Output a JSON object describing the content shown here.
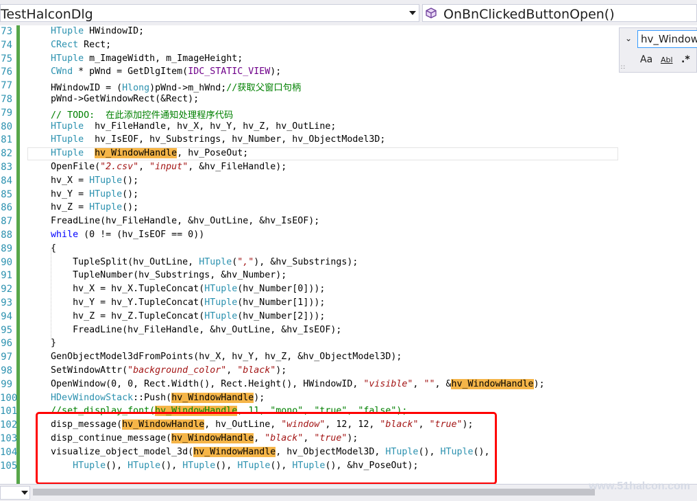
{
  "header": {
    "class_combo": "TestHalconDlg",
    "method_combo": "OnBnClickedButtonOpen()"
  },
  "find": {
    "query": "hv_Window",
    "opt_case": "Aa",
    "opt_word": "Abl",
    "opt_regex": ".*"
  },
  "watermark": "www.51halcon.com",
  "lines": [
    {
      "n": "73",
      "t": [
        [
          "        "
        ],
        [
          "HTuple",
          "type"
        ],
        [
          " HWindowID;"
        ]
      ]
    },
    {
      "n": "74",
      "t": [
        [
          "        "
        ],
        [
          "CRect",
          "type"
        ],
        [
          " Rect;"
        ]
      ]
    },
    {
      "n": "75",
      "t": [
        [
          "        "
        ],
        [
          "HTuple",
          "type"
        ],
        [
          " m_ImageWidth, m_ImageHeight;"
        ]
      ]
    },
    {
      "n": "76",
      "t": [
        [
          "        "
        ],
        [
          "CWnd",
          "type"
        ],
        [
          " * pWnd = GetDlgItem("
        ],
        [
          "IDC_STATIC_VIEW",
          "mac"
        ],
        [
          ");"
        ]
      ]
    },
    {
      "n": "77",
      "t": [
        [
          "        HWindowID = ("
        ],
        [
          "Hlong",
          "type"
        ],
        [
          ")pWnd->m_hWnd;"
        ],
        [
          "//获取父窗口句柄",
          "cmt"
        ]
      ]
    },
    {
      "n": "78",
      "t": [
        [
          "        pWnd->GetWindowRect(&Rect);"
        ]
      ]
    },
    {
      "n": "79",
      "t": [
        [
          "        "
        ],
        [
          "// TODO:  在此添加控件通知处理程序代码",
          "cmt"
        ]
      ]
    },
    {
      "n": "80",
      "t": [
        [
          "        "
        ],
        [
          "HTuple",
          "type"
        ],
        [
          "  hv_FileHandle, hv_X, hv_Y, hv_Z, hv_OutLine;"
        ]
      ]
    },
    {
      "n": "81",
      "t": [
        [
          "        "
        ],
        [
          "HTuple",
          "type"
        ],
        [
          "  hv_IsEOF, hv_Substrings, hv_Number, hv_ObjectModel3D;"
        ]
      ]
    },
    {
      "n": "82",
      "t": [
        [
          "        "
        ],
        [
          "HTuple",
          "type"
        ],
        [
          "  "
        ],
        [
          "hv_WindowHandle",
          "hl"
        ],
        [
          ", hv_PoseOut;"
        ]
      ]
    },
    {
      "n": "83",
      "t": [
        [
          "        OpenFile("
        ],
        [
          "\"2.csv\"",
          "str"
        ],
        [
          ", "
        ],
        [
          "\"input\"",
          "str"
        ],
        [
          ", &hv_FileHandle);"
        ]
      ]
    },
    {
      "n": "84",
      "t": [
        [
          "        hv_X = "
        ],
        [
          "HTuple",
          "type"
        ],
        [
          "();"
        ]
      ]
    },
    {
      "n": "85",
      "t": [
        [
          "        hv_Y = "
        ],
        [
          "HTuple",
          "type"
        ],
        [
          "();"
        ]
      ]
    },
    {
      "n": "86",
      "t": [
        [
          "        hv_Z = "
        ],
        [
          "HTuple",
          "type"
        ],
        [
          "();"
        ]
      ]
    },
    {
      "n": "87",
      "t": [
        [
          "        FreadLine(hv_FileHandle, &hv_OutLine, &hv_IsEOF);"
        ]
      ]
    },
    {
      "n": "88",
      "t": [
        [
          "        "
        ],
        [
          "while",
          "kw"
        ],
        [
          " (0 != (hv_IsEOF == 0))"
        ]
      ]
    },
    {
      "n": "89",
      "t": [
        [
          "        {"
        ]
      ]
    },
    {
      "n": "90",
      "t": [
        [
          "            TupleSplit(hv_OutLine, "
        ],
        [
          "HTuple",
          "type"
        ],
        [
          "("
        ],
        [
          "\",\"",
          "str"
        ],
        [
          "), &hv_Substrings);"
        ]
      ]
    },
    {
      "n": "91",
      "t": [
        [
          "            TupleNumber(hv_Substrings, &hv_Number);"
        ]
      ]
    },
    {
      "n": "92",
      "t": [
        [
          "            hv_X = hv_X.TupleConcat("
        ],
        [
          "HTuple",
          "type"
        ],
        [
          "(hv_Number[0]));"
        ]
      ]
    },
    {
      "n": "93",
      "t": [
        [
          "            hv_Y = hv_Y.TupleConcat("
        ],
        [
          "HTuple",
          "type"
        ],
        [
          "(hv_Number[1]));"
        ]
      ]
    },
    {
      "n": "94",
      "t": [
        [
          "            hv_Z = hv_Z.TupleConcat("
        ],
        [
          "HTuple",
          "type"
        ],
        [
          "(hv_Number[2]));"
        ]
      ]
    },
    {
      "n": "95",
      "t": [
        [
          "            FreadLine(hv_FileHandle, &hv_OutLine, &hv_IsEOF);"
        ]
      ]
    },
    {
      "n": "96",
      "t": [
        [
          "        }"
        ]
      ]
    },
    {
      "n": "97",
      "t": [
        [
          "        GenObjectModel3dFromPoints(hv_X, hv_Y, hv_Z, &hv_ObjectModel3D);"
        ]
      ]
    },
    {
      "n": "98",
      "t": [
        [
          "        SetWindowAttr("
        ],
        [
          "\"background_color\"",
          "str"
        ],
        [
          ", "
        ],
        [
          "\"black\"",
          "str"
        ],
        [
          ");"
        ]
      ]
    },
    {
      "n": "99",
      "t": [
        [
          "        OpenWindow(0, 0, Rect.Width(), Rect.Height(), HWindowID, "
        ],
        [
          "\"visible\"",
          "str"
        ],
        [
          ", "
        ],
        [
          "\"\"",
          "str"
        ],
        [
          ", &"
        ],
        [
          "hv_WindowHandle",
          "hl"
        ],
        [
          ");"
        ]
      ]
    },
    {
      "n": "100",
      "t": [
        [
          "        "
        ],
        [
          "HDevWindowStack",
          "type"
        ],
        [
          "::Push("
        ],
        [
          "hv_WindowHandle",
          "hl"
        ],
        [
          ");"
        ]
      ]
    },
    {
      "n": "101",
      "t": [
        [
          "        "
        ],
        [
          "//set_display_font(",
          "cmt"
        ],
        [
          "hv_WindowHandle",
          "hl cmt"
        ],
        [
          ", 11, \"mono\", \"true\", \"false\");",
          "cmt"
        ]
      ]
    },
    {
      "n": "102",
      "t": [
        [
          "        disp_message("
        ],
        [
          "hv_WindowHandle",
          "hl"
        ],
        [
          ", hv_OutLine, "
        ],
        [
          "\"window\"",
          "str"
        ],
        [
          ", 12, 12, "
        ],
        [
          "\"black\"",
          "str"
        ],
        [
          ", "
        ],
        [
          "\"true\"",
          "str"
        ],
        [
          ");"
        ]
      ]
    },
    {
      "n": "103",
      "t": [
        [
          "        disp_continue_message("
        ],
        [
          "hv_WindowHandle",
          "hl"
        ],
        [
          ", "
        ],
        [
          "\"black\"",
          "str"
        ],
        [
          ", "
        ],
        [
          "\"true\"",
          "str"
        ],
        [
          ");"
        ]
      ]
    },
    {
      "n": "104",
      "t": [
        [
          "        visualize_object_model_3d("
        ],
        [
          "hv_WindowHandle",
          "hl"
        ],
        [
          ", hv_ObjectModel3D, "
        ],
        [
          "HTuple",
          "type"
        ],
        [
          "(), "
        ],
        [
          "HTuple",
          "type"
        ],
        [
          "(),"
        ]
      ]
    },
    {
      "n": "105",
      "t": [
        [
          "            "
        ],
        [
          "HTuple",
          "type"
        ],
        [
          "(), "
        ],
        [
          "HTuple",
          "type"
        ],
        [
          "(), "
        ],
        [
          "HTuple",
          "type"
        ],
        [
          "(), "
        ],
        [
          "HTuple",
          "type"
        ],
        [
          "(), "
        ],
        [
          "HTuple",
          "type"
        ],
        [
          "(), &hv_PoseOut);"
        ]
      ]
    }
  ]
}
